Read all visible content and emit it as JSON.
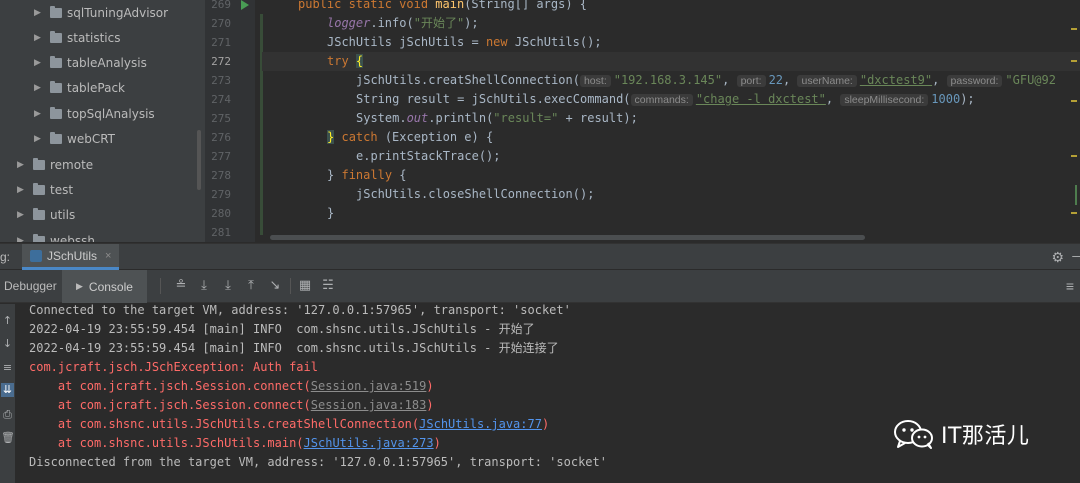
{
  "project_tree": {
    "items": [
      {
        "label": "sqlTuningAdvisor",
        "depth": 1
      },
      {
        "label": "statistics",
        "depth": 1
      },
      {
        "label": "tableAnalysis",
        "depth": 1
      },
      {
        "label": "tablePack",
        "depth": 1
      },
      {
        "label": "topSqlAnalysis",
        "depth": 1
      },
      {
        "label": "webCRT",
        "depth": 1
      },
      {
        "label": "remote",
        "depth": 0
      },
      {
        "label": "test",
        "depth": 0
      },
      {
        "label": "utils",
        "depth": 0
      },
      {
        "label": "webssh",
        "depth": 0
      }
    ]
  },
  "editor": {
    "current_line": "272",
    "line_numbers": [
      "269",
      "270",
      "271",
      "272",
      "273",
      "274",
      "275",
      "276",
      "277",
      "278",
      "279",
      "280",
      "281"
    ],
    "code": {
      "l269": "public static void main(String[] args) {",
      "l270_a": "logger",
      "l270_b": ".info(",
      "l270_c": "\"开始了\"",
      "l270_d": ");",
      "l271": "JSchUtils jSchUtils = new JSchUtils();",
      "l272_kw": "try",
      "l272_brace": "{",
      "l273_a": "jSchUtils.creatShellConnection(",
      "l273_hint_host": "host:",
      "l273_host": "\"192.168.3.145\"",
      "l273_hint_port": "port:",
      "l273_port": "22",
      "l273_hint_user": "userName:",
      "l273_user": "\"dxctest9\"",
      "l273_hint_pw": "password:",
      "l273_pw": "\"GFU@92",
      "l274_a": "String result = jSchUtils.execCommand(",
      "l274_hint_cmd": "commands:",
      "l274_cmd": "\"chage -l dxctest\"",
      "l274_hint_sleep": "sleepMillisecond:",
      "l274_sleep": "1000",
      "l274_end": ");",
      "l275_a": "System.",
      "l275_out": "out",
      "l275_b": ".println(",
      "l275_str": "\"result=\"",
      "l275_c": " + result);",
      "l276_brace": "}",
      "l276_kw": "catch",
      "l276_rest": " (Exception e) {",
      "l277": "e.printStackTrace();",
      "l278_brace": "}",
      "l278_kw": "finally",
      "l278_rest": " {",
      "l279": "jSchUtils.closeShellConnection();",
      "l280": "}"
    }
  },
  "run_window": {
    "prefix": "g:",
    "tab_label": "JSchUtils",
    "close_glyph": "×",
    "debugger_label": "Debugger",
    "console_label": "Console"
  },
  "console": {
    "lines": [
      {
        "text": "Connected to the target VM, address: '127.0.0.1:57965', transport: 'socket'"
      },
      {
        "text": "2022-04-19 23:55:59.454 [main] INFO  com.shsnc.utils.JSchUtils - 开始了"
      },
      {
        "text": "2022-04-19 23:55:59.454 [main] INFO  com.shsnc.utils.JSchUtils - 开始连接了"
      },
      {
        "text": "com.jcraft.jsch.JSchException: Auth fail"
      },
      {
        "prefix": "    at com.jcraft.jsch.Session.connect(",
        "link": "Session.java:519",
        "suffix": ")"
      },
      {
        "prefix": "    at com.jcraft.jsch.Session.connect(",
        "link": "Session.java:183",
        "suffix": ")"
      },
      {
        "prefix": "    at com.shsnc.utils.JSchUtils.creatShellConnection(",
        "link": "JSchUtils.java:77",
        "suffix": ")"
      },
      {
        "prefix": "    at com.shsnc.utils.JSchUtils.main(",
        "link": "JSchUtils.java:273",
        "suffix": ")"
      },
      {
        "text": "Disconnected from the target VM, address: '127.0.0.1:57965', transport: 'socket'"
      }
    ]
  },
  "watermark": {
    "text": "IT那活儿",
    "logo": "wechat-logo"
  },
  "colors": {
    "keyword": "#cc7832",
    "string": "#6a8759",
    "number": "#6897bb",
    "error": "#ff6b68",
    "link": "#5394ec"
  }
}
